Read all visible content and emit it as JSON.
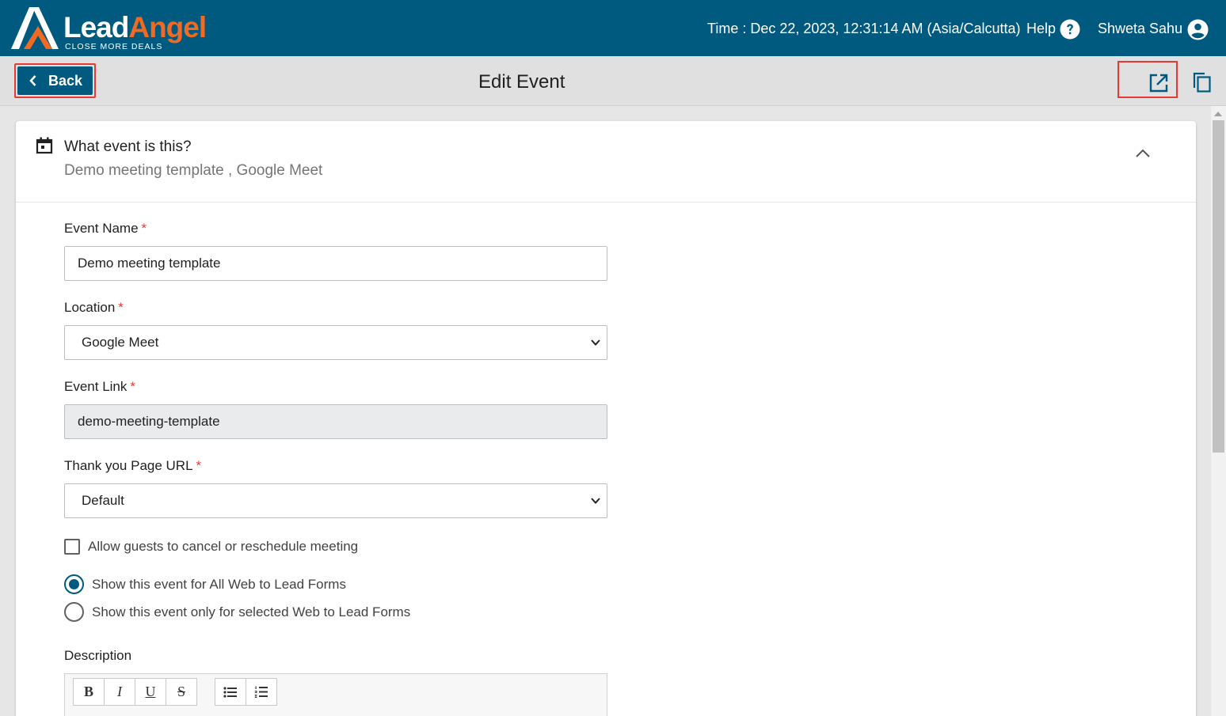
{
  "header": {
    "logo": {
      "lead": "Lead",
      "angel": "Angel",
      "tagline": "CLOSE MORE DEALS"
    },
    "time": "Time : Dec 22, 2023, 12:31:14 AM (Asia/Calcutta)",
    "help_label": "Help",
    "user_name": "Shweta Sahu",
    "icons": {
      "help": "help-circle-icon",
      "user": "account-circle-icon"
    }
  },
  "subheader": {
    "back_label": "Back",
    "title": "Edit Event",
    "icons": {
      "back": "chevron-left-icon",
      "open": "open-in-new-icon",
      "copy": "copy-icon"
    }
  },
  "event_card": {
    "question": "What event is this?",
    "summary": "Demo meeting template , Google Meet",
    "icons": {
      "header": "calendar-icon",
      "toggle": "chevron-up-icon"
    }
  },
  "form": {
    "required_marker": "*",
    "event_name": {
      "label": "Event Name",
      "value": "Demo meeting template"
    },
    "location": {
      "label": "Location",
      "value": "Google Meet"
    },
    "event_link": {
      "label": "Event Link",
      "value": "demo-meeting-template"
    },
    "thank_you_url": {
      "label": "Thank you Page URL",
      "value": "Default"
    },
    "allow_guests": {
      "label": "Allow guests to cancel or reschedule meeting",
      "checked": false
    },
    "visibility": {
      "options": [
        {
          "label": "Show this event for All Web to Lead Forms",
          "selected": true
        },
        {
          "label": "Show this event only for selected Web to Lead Forms",
          "selected": false
        }
      ]
    },
    "description": {
      "label": "Description",
      "toolbar": {
        "bold": "B",
        "italic": "I",
        "underline": "U",
        "strike": "S"
      }
    }
  },
  "colors": {
    "brand": "#005a80",
    "accent": "#f26a21",
    "required": "#e53935",
    "highlight": "#e53935"
  }
}
